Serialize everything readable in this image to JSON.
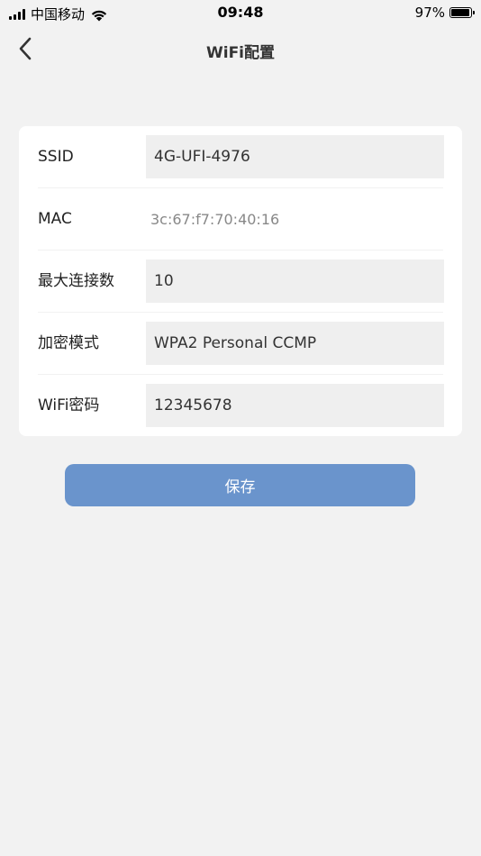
{
  "status_bar": {
    "carrier": "中国移动",
    "time": "09:48",
    "battery_percent": "97%",
    "battery_level": 0.97,
    "icons": [
      "signal-icon",
      "wifi-icon",
      "battery-icon"
    ]
  },
  "nav": {
    "title": "WiFi配置",
    "back_icon": "chevron-left-icon"
  },
  "form": {
    "ssid": {
      "label": "SSID",
      "value": "4G-UFI-4976"
    },
    "mac": {
      "label": "MAC",
      "value": "3c:67:f7:70:40:16"
    },
    "max_connections": {
      "label": "最大连接数",
      "value": "10"
    },
    "encryption": {
      "label": "加密模式",
      "value": "WPA2 Personal CCMP"
    },
    "password": {
      "label": "WiFi密码",
      "value": "12345678"
    }
  },
  "save_button": {
    "label": "保存"
  },
  "colors": {
    "background": "#f2f2f2",
    "card": "#ffffff",
    "input_bg": "#efefef",
    "button": "#6a94cc"
  }
}
